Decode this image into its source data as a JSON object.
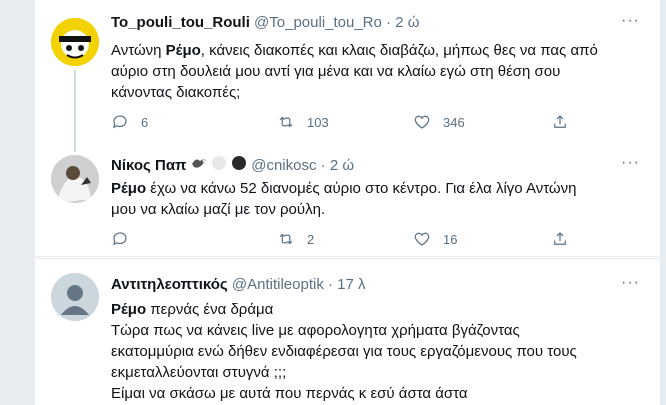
{
  "tweets": [
    {
      "name": "To_pouli_tou_Rouli",
      "handle": "@To_pouli_tou_Ro",
      "separator": "·",
      "time": "2 ώ",
      "text_lines": [
        {
          "bold": "Ρέμο",
          "prefix": "Αντώνη ",
          "rest": ", κάνεις διακοπές και κλαις διαβάζω, μήπως θες να πας από"
        },
        {
          "plain": "αύριο στη δουλειά μου αντί για μένα και να κλαίω εγώ στη θέση σου"
        },
        {
          "plain": "κάνοντας διακοπές;"
        }
      ],
      "replies": "6",
      "retweets": "103",
      "likes": "346"
    },
    {
      "name": "Νίκος Παπ",
      "handle": "@cnikosc",
      "separator": "·",
      "time": "2 ώ",
      "text_lines": [
        {
          "bold": "Ρέμο",
          "prefix": "",
          "rest": " έχω να κάνω 52 διανομές αύριο στο κέντρο. Για έλα λίγο Αντώνη"
        },
        {
          "plain": "μου να κλαίω μαζί με τον ρούλη."
        }
      ],
      "replies": "",
      "retweets": "2",
      "likes": "16"
    },
    {
      "name": "Αντιτηλεοπτικός",
      "handle": "@Antitileoptik",
      "separator": "·",
      "time": "17 λ",
      "text_lines": [
        {
          "bold": "Ρέμο",
          "prefix": "",
          "rest": " περνάς ένα δράμα"
        },
        {
          "plain": "Τώρα πως να κάνεις live με αφορολογητα χρήματα βγάζοντας"
        },
        {
          "plain": "εκατομμύρια ενώ δήθεν ενδιαφέρεσαι για τους εργαζόμενους που τους"
        },
        {
          "plain": "εκμεταλλεύονται στυγνά ;;;"
        },
        {
          "plain": "Είμαι να σκάσω με αυτά που περνάς κ εσύ άστα άστα"
        }
      ]
    }
  ],
  "more_label": "···",
  "colors": {
    "accent": "#1da1f2",
    "muted": "#5b7083",
    "border": "#e6ecf0"
  }
}
